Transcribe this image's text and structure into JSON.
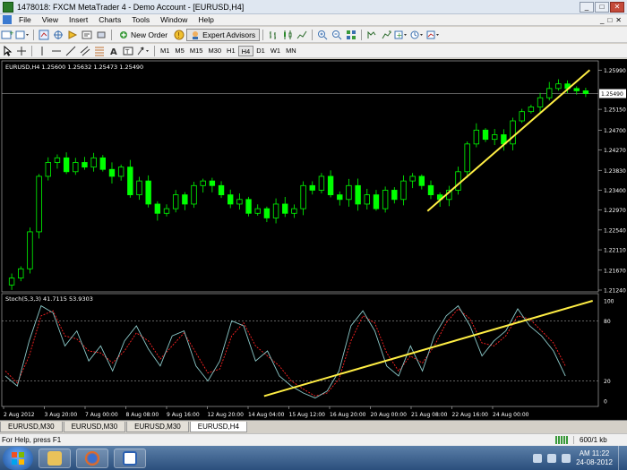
{
  "window": {
    "title": "1478018: FXCM MetaTrader 4 - Demo Account - [EURUSD,H4]",
    "controls": [
      "_",
      "□",
      "✕"
    ]
  },
  "menu": {
    "items": [
      "File",
      "View",
      "Insert",
      "Charts",
      "Tools",
      "Window",
      "Help"
    ],
    "right_controls": [
      "_",
      "□",
      "✕"
    ]
  },
  "toolbar": {
    "new_order_label": "New Order",
    "expert_advisors_label": "Expert Advisors",
    "timeframes": [
      "M1",
      "M5",
      "M15",
      "M30",
      "H1",
      "H4",
      "D1",
      "W1",
      "MN"
    ],
    "active_timeframe": "H4"
  },
  "chart": {
    "header": "EURUSD,H4  1.25600 1.25632 1.25473 1.25490",
    "indicator_header": "Stoch(5,3,3) 41.7115 53.9303",
    "colors": {
      "background": "#000000",
      "bull": "#00ff00",
      "bear": "#00ff00",
      "trendline": "#ffee44",
      "stoch_main": "#8ac7c7",
      "stoch_signal": "#ff2222",
      "axis_text": "#ffffff"
    }
  },
  "chart_data": {
    "type": "candlestick",
    "symbol": "EURUSD",
    "timeframe": "H4",
    "price_axis_labels": [
      "1.25990",
      "1.25150",
      "1.24700",
      "1.24270",
      "1.23830",
      "1.23400",
      "1.22970",
      "1.22540",
      "1.22110",
      "1.21670",
      "1.21240"
    ],
    "current_price": "1.25490",
    "ylim": [
      1.2124,
      1.2612
    ],
    "time_axis_labels": [
      "2 Aug 2012",
      "3 Aug 20:00",
      "7 Aug 00:00",
      "8 Aug 08:00",
      "9 Aug 16:00",
      "12 Aug 20:00",
      "14 Aug 04:00",
      "15 Aug 12:00",
      "16 Aug 20:00",
      "20 Aug 00:00",
      "21 Aug 08:00",
      "22 Aug 16:00",
      "24 Aug 00:00"
    ],
    "close_path": [
      1.215,
      1.217,
      1.225,
      1.237,
      1.24,
      1.241,
      1.238,
      1.24,
      1.239,
      1.241,
      1.2385,
      1.237,
      1.239,
      1.233,
      1.236,
      1.231,
      1.229,
      1.23,
      1.233,
      1.231,
      1.235,
      1.236,
      1.235,
      1.233,
      1.231,
      1.232,
      1.229,
      1.23,
      1.228,
      1.231,
      1.229,
      1.23,
      1.235,
      1.234,
      1.237,
      1.233,
      1.232,
      1.235,
      1.231,
      1.233,
      1.23,
      1.234,
      1.232,
      1.236,
      1.237,
      1.235,
      1.233,
      1.232,
      1.234,
      1.238,
      1.244,
      1.247,
      1.245,
      1.246,
      1.244,
      1.249,
      1.251,
      1.252,
      1.254,
      1.256,
      1.257,
      1.256,
      1.2555,
      1.2549
    ],
    "trendline_price": {
      "from": [
        0.716,
        1.2295
      ],
      "to": [
        0.99,
        1.26
      ]
    },
    "stochastic": {
      "levels": [
        "100",
        "80",
        "20",
        "0"
      ],
      "main_path": [
        25,
        15,
        60,
        95,
        88,
        55,
        70,
        40,
        55,
        30,
        60,
        75,
        52,
        35,
        65,
        70,
        35,
        20,
        40,
        80,
        75,
        40,
        50,
        25,
        15,
        8,
        3,
        10,
        30,
        75,
        90,
        70,
        35,
        25,
        55,
        30,
        65,
        85,
        95,
        75,
        45,
        60,
        70,
        92,
        75,
        65,
        50,
        25
      ],
      "signal_path": [
        30,
        18,
        45,
        85,
        90,
        65,
        62,
        50,
        48,
        38,
        50,
        68,
        60,
        42,
        55,
        68,
        48,
        28,
        32,
        65,
        78,
        55,
        45,
        35,
        20,
        12,
        5,
        8,
        22,
        60,
        85,
        78,
        48,
        30,
        45,
        38,
        55,
        78,
        92,
        82,
        58,
        55,
        65,
        85,
        82,
        70,
        58,
        35
      ],
      "trendline": {
        "from": [
          0.44,
          5
        ],
        "to": [
          0.995,
          100
        ]
      }
    }
  },
  "tabs": {
    "items": [
      "EURUSD,M30",
      "EURUSD,M30",
      "EURUSD,M30",
      "EURUSD,H4"
    ],
    "active_index": 3
  },
  "status": {
    "help": "For Help, press F1",
    "traffic": "600/1 kb"
  },
  "taskbar": {
    "clock_time": "AM 11:22",
    "clock_date": "24-08-2012"
  }
}
